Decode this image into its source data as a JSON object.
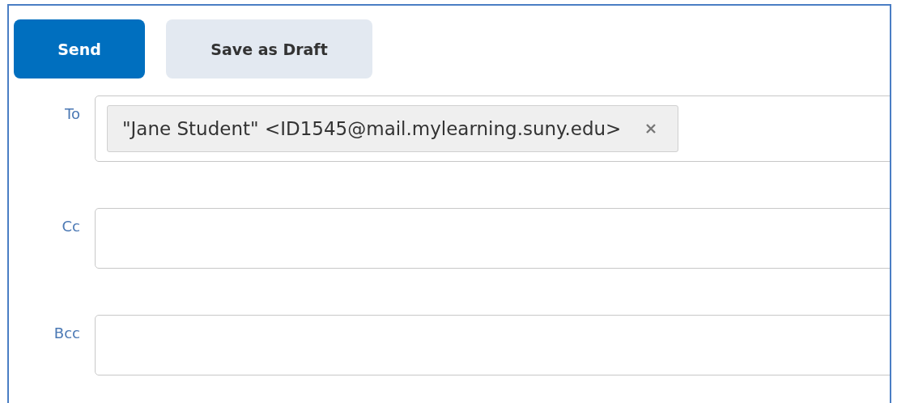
{
  "buttons": [
    {
      "label": "Send",
      "kind": "primary"
    },
    {
      "label": "Save as Draft",
      "kind": "secondary"
    }
  ],
  "fields": [
    {
      "label": "To",
      "recipients": [
        {
          "text": "\"Jane Student\" <ID1545@mail.mylearning.suny.edu>"
        }
      ]
    },
    {
      "label": "Cc"
    },
    {
      "label": "Bcc"
    }
  ]
}
